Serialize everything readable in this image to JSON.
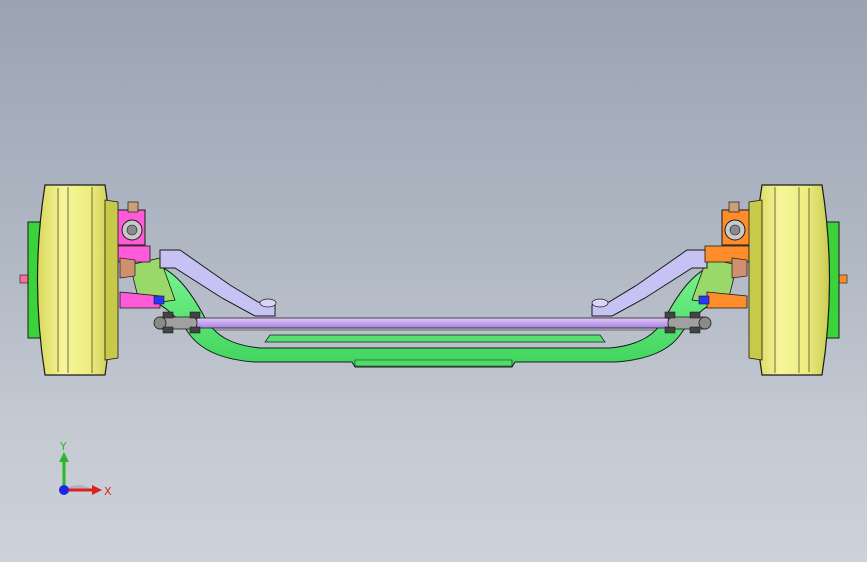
{
  "viewport": {
    "background_top": "#9aa4b1",
    "background_bottom": "#cdd2da"
  },
  "model": {
    "colors": {
      "wheel_drum": "#f2f28c",
      "wheel_shade": "#dede6a",
      "hub": "#3ad43a",
      "axle_beam": "#5ff07a",
      "upper_arm": "#c7c2f4",
      "tie_rod": "#c9a6ee",
      "knuckle_left": "#ff5ad8",
      "knuckle_right": "#ff8c2a",
      "steering_arm": "#9ad86a",
      "tie_rod_end": "#9a9a9a",
      "accent_blue": "#2a38ff",
      "stud": "#ff6a9a"
    },
    "parts": [
      "left-wheel",
      "right-wheel",
      "front-axle-beam",
      "upper-link-left",
      "upper-link-right",
      "tie-rod",
      "left-knuckle",
      "right-knuckle"
    ]
  },
  "triad": {
    "y_label": "Y",
    "x_label": "X",
    "y_color": "#2ab82a",
    "x_color": "#e02020",
    "z_color": "#1a28e0"
  }
}
